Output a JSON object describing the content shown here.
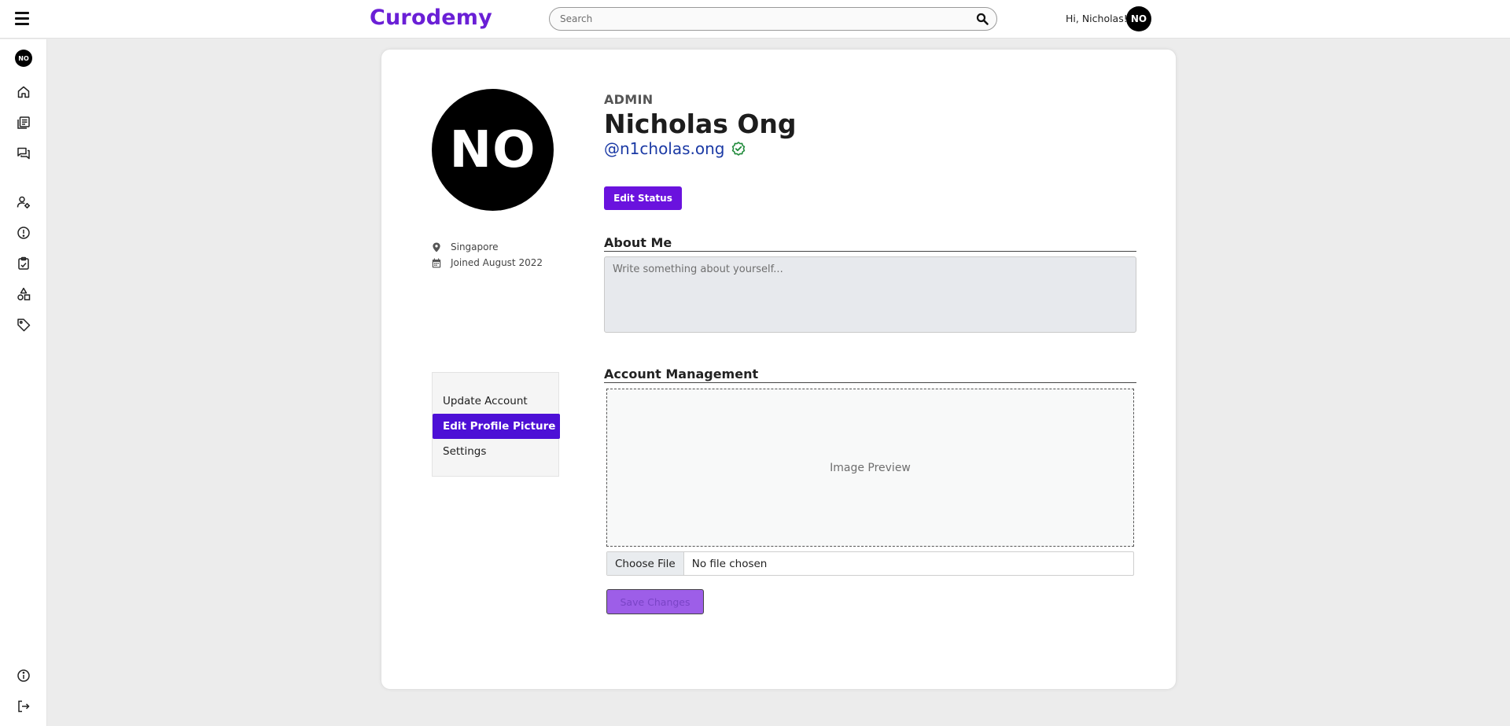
{
  "app": {
    "brand": "Curodemy"
  },
  "header": {
    "search_placeholder": "Search",
    "greeting": "Hi, Nicholas!",
    "avatar_initials": "NO"
  },
  "sidebar": {
    "avatar_initials": "NO",
    "icons": [
      "home-icon",
      "courses-icon",
      "forum-icon",
      "user-settings-icon",
      "alert-icon",
      "clipboard-icon",
      "shapes-icon",
      "tag-icon",
      "info-icon",
      "logout-icon"
    ]
  },
  "profile": {
    "avatar_initials": "NO",
    "role": "ADMIN",
    "name": "Nicholas Ong",
    "handle": "@n1cholas.ong",
    "verified": true,
    "location": "Singapore",
    "joined": "Joined August 2022",
    "edit_status_label": "Edit Status"
  },
  "about": {
    "title": "About Me",
    "placeholder": "Write something about yourself..."
  },
  "account_menu": {
    "items": [
      {
        "label": "Update Account",
        "active": false
      },
      {
        "label": "Edit Profile Picture",
        "active": true
      },
      {
        "label": "Settings",
        "active": false
      }
    ]
  },
  "account_management": {
    "title": "Account Management",
    "preview_label": "Image Preview",
    "choose_file_label": "Choose File",
    "file_status": "No file chosen",
    "save_label": "Save Changes"
  },
  "colors": {
    "brand": "#6a1fd6",
    "primary_button": "#6a12de",
    "active_menu": "#4d10d6",
    "handle": "#1b3aa5",
    "verified": "#1f8a3a",
    "save_button": "#9d5ee8"
  }
}
